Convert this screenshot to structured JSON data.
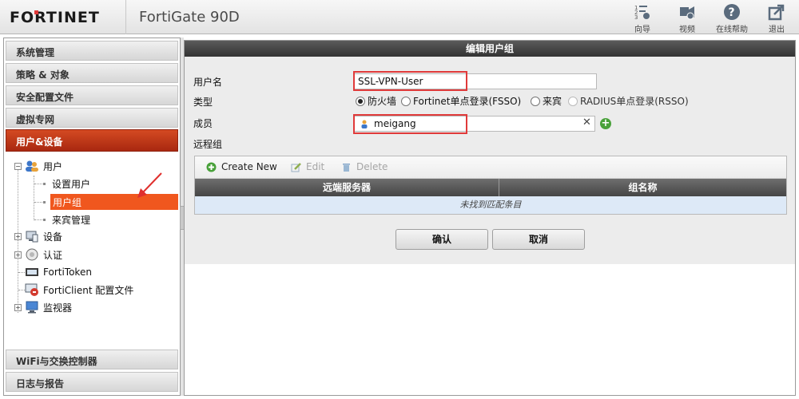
{
  "header": {
    "brand": "FORTINET",
    "model": "FortiGate 90D",
    "buttons": [
      {
        "label": "向导",
        "icon": "wizard-icon"
      },
      {
        "label": "视频",
        "icon": "video-icon"
      },
      {
        "label": "在线帮助",
        "icon": "help-icon"
      },
      {
        "label": "退出",
        "icon": "logout-icon"
      }
    ]
  },
  "sidebar": {
    "sections_top": [
      "系统管理",
      "策略 & 对象",
      "安全配置文件",
      "虚拟专网"
    ],
    "active_section": "用户&设备",
    "tree": {
      "user": "用户",
      "user_children": [
        "设置用户",
        "用户组",
        "来宾管理"
      ],
      "device": "设备",
      "auth": "认证",
      "fortitoken": "FortiToken",
      "forticlient": "FortiClient 配置文件",
      "monitor": "监视器"
    },
    "sections_bottom": [
      "WiFi与交换控制器",
      "日志与报告"
    ]
  },
  "main": {
    "title": "编辑用户组",
    "form": {
      "name_label": "用户名",
      "name_value": "SSL-VPN-User",
      "type_label": "类型",
      "type_options": [
        "防火墙",
        "Fortinet单点登录(FSSO)",
        "来宾",
        "RADIUS单点登录(RSSO)"
      ],
      "type_selected": "防火墙",
      "member_label": "成员",
      "member_value": "meigang",
      "remote_label": "远程组"
    },
    "grid": {
      "toolbar": {
        "create": "Create New",
        "edit": "Edit",
        "delete": "Delete"
      },
      "columns": [
        "远端服务器",
        "组名称"
      ],
      "empty_text": "未找到匹配条目"
    },
    "buttons": {
      "ok": "确认",
      "cancel": "取消"
    }
  }
}
